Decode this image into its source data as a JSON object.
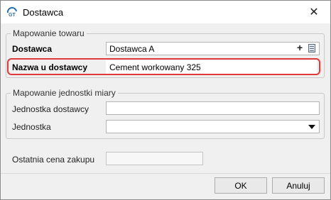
{
  "window": {
    "title": "Dostawca",
    "app_icon": "gt-app-icon",
    "close_glyph": "✕"
  },
  "mapping_group": {
    "legend": "Mapowanie towaru",
    "supplier_label": "Dostawca",
    "supplier_value": "Dostawca A",
    "add_glyph": "+",
    "supplier_name_label": "Nazwa u dostawcy",
    "supplier_name_value": "Cement workowany 325"
  },
  "unit_group": {
    "legend": "Mapowanie jednostki miary",
    "supplier_unit_label": "Jednostka dostawcy",
    "supplier_unit_value": "",
    "unit_label": "Jednostka",
    "unit_value": ""
  },
  "last_price": {
    "label": "Ostatnia cena zakupu",
    "value": ""
  },
  "buttons": {
    "ok": "OK",
    "cancel": "Anuluj"
  },
  "colors": {
    "highlight": "#e23a3a",
    "title_bg": "#ffffff",
    "dialog_bg": "#f0f0f0"
  }
}
